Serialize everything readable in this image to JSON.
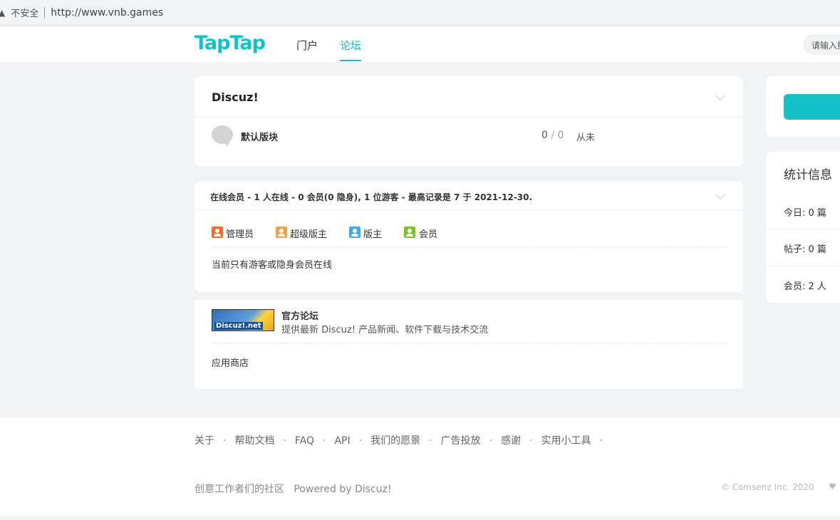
{
  "browser": {
    "warning_icon": "▲",
    "security_label": "不安全",
    "url": "http://www.vnb.games"
  },
  "nav": {
    "logo": "TapTap",
    "links": [
      "门户",
      "论坛"
    ],
    "active": "论坛",
    "search_placeholder": "请输入搜索内容"
  },
  "forum_category": {
    "title": "Discuz!",
    "forum_name": "默认版块",
    "threads": "0",
    "slash": "/",
    "posts": "0",
    "last_post": "从未"
  },
  "online": {
    "title": "在线会员",
    "summary": " - 1 人在线 - 0 会员(0 隐身), 1 位游客 - 最高记录是 7 于 2021-12-30.",
    "groups": [
      {
        "label": "管理员",
        "color": "#ef6e2e"
      },
      {
        "label": "超级版主",
        "color": "#f0a24a"
      },
      {
        "label": "版主",
        "color": "#4aa8e0"
      },
      {
        "label": "会员",
        "color": "#7cc22a"
      }
    ],
    "note": "当前只有游客或隐身会员在线"
  },
  "links": {
    "banner_text": "Discuz!.net",
    "title": "官方论坛",
    "desc": "提供最新 Discuz! 产品新闻、软件下载与技术交流",
    "app_store": "应用商店"
  },
  "stats": {
    "title": "统计信息",
    "today": "今日: 0 篇",
    "posts": "帖子: 0 篇",
    "members": "会员: 2 人"
  },
  "footer": {
    "links": [
      "关于",
      "帮助文档",
      "FAQ",
      "API",
      "我们的愿景",
      "广告投放",
      "感谢",
      "实用小工具"
    ],
    "slogan": "创意工作者们的社区",
    "powered": "Powered by Discuz!",
    "copyright": "© Comsenz Inc. 2020"
  },
  "colors": {
    "accent": "#14c1c8"
  }
}
